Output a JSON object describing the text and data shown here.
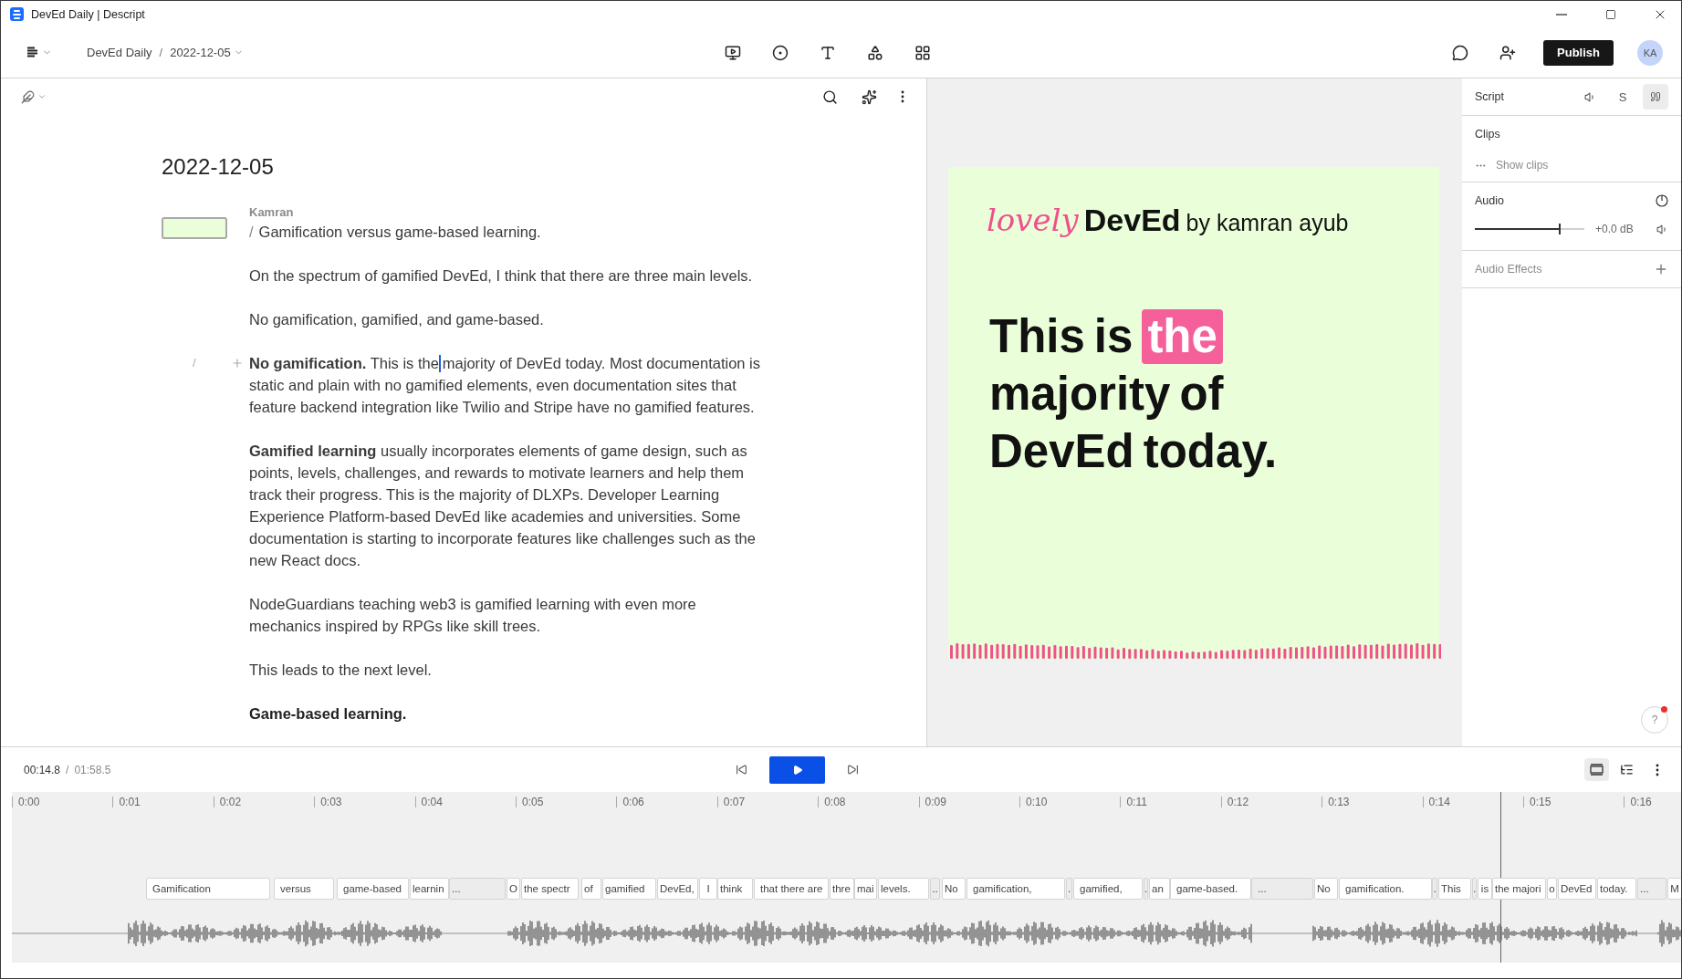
{
  "window": {
    "title": "DevEd Daily | Descript"
  },
  "top_bar": {
    "breadcrumb": [
      {
        "label": "DevEd Daily",
        "dropdown": false
      },
      {
        "label": "2022-12-05",
        "dropdown": true
      }
    ],
    "separator": "/",
    "publish": "Publish",
    "avatar": "KA"
  },
  "editor": {
    "heading": "2022-12-05",
    "speaker": "Kamran",
    "paragraphs": [
      {
        "kind": "body",
        "prefix": "/",
        "text": "Gamification versus game-based learning."
      },
      {
        "kind": "body",
        "text": "On the spectrum of gamified DevEd, I think that there are three main levels."
      },
      {
        "kind": "body",
        "text": "No gamification, gamified, and game-based."
      },
      {
        "kind": "body",
        "gutter": "/",
        "text": "**No gamification.** This is the",
        "text_after_caret": "majority of DevEd today. Most documentation is static and plain with no gamified elements, even documentation sites that feature backend integration like Twilio and Stripe have no gamified features."
      },
      {
        "kind": "body",
        "text": "**Gamified learning** usually incorporates elements of game design, such as points, levels, challenges, and rewards to motivate learners and help them track their progress. This is the majority of DLXPs. Developer Learning Experience Platform-based DevEd like academies and universities. Some documentation is starting to incorporate features like challenges such as the new React docs."
      },
      {
        "kind": "body",
        "text": "NodeGuardians teaching web3 is gamified learning with even more mechanics inspired by RPGs like skill trees."
      },
      {
        "kind": "body",
        "text": "This leads to the next level."
      },
      {
        "kind": "heading",
        "text": "Game-based learning."
      }
    ]
  },
  "preview": {
    "logo": {
      "script": "lovely",
      "brand": "DevEd",
      "byline": "by kamran ayub"
    },
    "caption_lines": [
      {
        "words": [
          {
            "text": "This",
            "highlighted": false
          },
          {
            "text": "is",
            "highlighted": false
          },
          {
            "text": "the",
            "highlighted": true
          }
        ]
      },
      {
        "words": [
          {
            "text": "majority",
            "highlighted": false
          },
          {
            "text": "of",
            "highlighted": false
          }
        ]
      },
      {
        "words": [
          {
            "text": "DevEd",
            "highlighted": false
          },
          {
            "text": "today.",
            "highlighted": false
          }
        ]
      }
    ]
  },
  "right_panel": {
    "title": "Script",
    "tabs": [
      {
        "kind": "speaker",
        "selected": false
      },
      {
        "kind": "text",
        "label": "S",
        "selected": false
      },
      {
        "kind": "quote",
        "selected": true
      }
    ],
    "clips": {
      "title": "Clips",
      "action": "Show clips"
    },
    "audio": {
      "title": "Audio",
      "level": 0.77,
      "reading": "+0.0 dB"
    },
    "audio_effects": {
      "title": "Audio Effects"
    },
    "help": {
      "label": "?",
      "notification": true
    }
  },
  "transport": {
    "current": "00:14.8",
    "separator": "/",
    "total": "01:58.5",
    "view_modes": [
      {
        "kind": "clip",
        "selected": true
      },
      {
        "kind": "tracks",
        "selected": false
      }
    ]
  },
  "timeline": {
    "ticks": [
      "0:00",
      "0:01",
      "0:02",
      "0:03",
      "0:04",
      "0:05",
      "0:06",
      "0:07",
      "0:08",
      "0:09",
      "0:10",
      "0:11",
      "0:12",
      "0:13",
      "0:14",
      "0:15",
      "0:16"
    ],
    "words": [
      {
        "text": "Gamification",
        "kind": "word"
      },
      {
        "text": "versus",
        "kind": "word"
      },
      {
        "text": "game-based",
        "kind": "word"
      },
      {
        "text": "learnin",
        "kind": "word"
      },
      {
        "text": "...",
        "kind": "gap"
      },
      {
        "text": "O",
        "kind": "word"
      },
      {
        "text": "the spectr",
        "kind": "word"
      },
      {
        "text": "of",
        "kind": "word"
      },
      {
        "text": "gamified",
        "kind": "word"
      },
      {
        "text": "DevEd,",
        "kind": "word"
      },
      {
        "text": "I",
        "kind": "word"
      },
      {
        "text": "think",
        "kind": "word"
      },
      {
        "text": "that there are",
        "kind": "word"
      },
      {
        "text": "thre",
        "kind": "word"
      },
      {
        "text": "mai",
        "kind": "word"
      },
      {
        "text": "levels.",
        "kind": "word"
      },
      {
        "text": "..",
        "kind": "gap"
      },
      {
        "text": "No",
        "kind": "word"
      },
      {
        "text": "gamification,",
        "kind": "word"
      },
      {
        "text": ".",
        "kind": "gap"
      },
      {
        "text": "gamified,",
        "kind": "word"
      },
      {
        "text": ".",
        "kind": "gap"
      },
      {
        "text": "an",
        "kind": "word"
      },
      {
        "text": "game-based.",
        "kind": "word"
      },
      {
        "text": "...",
        "kind": "gap"
      },
      {
        "text": "No",
        "kind": "word"
      },
      {
        "text": "gamification.",
        "kind": "word"
      },
      {
        "text": ".",
        "kind": "gap"
      },
      {
        "text": "This",
        "kind": "word"
      },
      {
        "text": ".",
        "kind": "gap"
      },
      {
        "text": "is",
        "kind": "word"
      },
      {
        "text": "the majori",
        "kind": "word"
      },
      {
        "text": "o",
        "kind": "word"
      },
      {
        "text": "DevEd",
        "kind": "word"
      },
      {
        "text": "today.",
        "kind": "word"
      },
      {
        "text": "...",
        "kind": "gap"
      },
      {
        "text": "M",
        "kind": "word"
      }
    ]
  }
}
